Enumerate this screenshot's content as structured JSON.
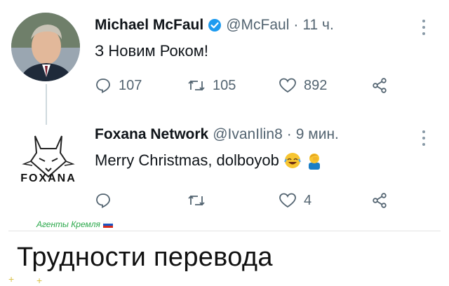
{
  "tweet1": {
    "name": "Michael McFaul",
    "handle": "@McFaul",
    "time": "11 ч.",
    "text": "З Новим Роком!",
    "replies": "107",
    "retweets": "105",
    "likes": "892"
  },
  "tweet2": {
    "name": "Foxana Network",
    "handle": "@IvanIlin8",
    "time": "9 мин.",
    "text": "Merry Christmas, dolboyob",
    "replies": "",
    "retweets": "",
    "likes": "4",
    "logo_text": "FOXANA"
  },
  "watermark": "Агенты Кремля",
  "caption": "Трудности перевода",
  "colors": {
    "verified": "#1d9bf0",
    "icons": "#536471",
    "watermark": "#2aa84a"
  }
}
